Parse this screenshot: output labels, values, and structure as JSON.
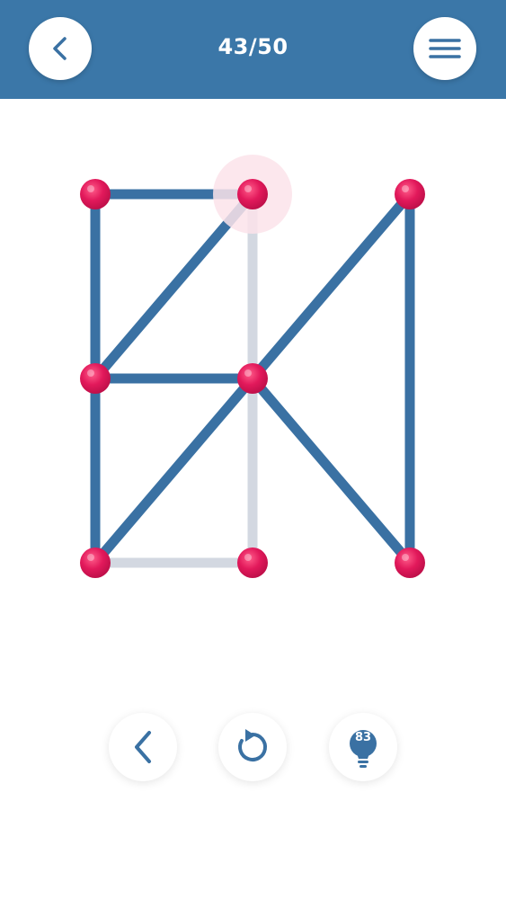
{
  "header": {
    "level_text": "43/50",
    "back_icon": "chevron-left-icon",
    "menu_icon": "hamburger-menu-icon"
  },
  "colors": {
    "header_bg": "#3b77a8",
    "drawn_line": "#3a71a3",
    "undrawn_line": "#d3d8e1",
    "node": "#e2195b",
    "node_highlight": "#fbe3ea"
  },
  "board": {
    "nodes": [
      {
        "id": "top-left"
      },
      {
        "id": "top-middle",
        "active": true
      },
      {
        "id": "top-right"
      },
      {
        "id": "middle-left"
      },
      {
        "id": "center"
      },
      {
        "id": "bottom-left"
      },
      {
        "id": "bottom-middle"
      },
      {
        "id": "bottom-right"
      }
    ],
    "edges": [
      {
        "from": "top-left",
        "to": "top-middle",
        "drawn": true
      },
      {
        "from": "top-left",
        "to": "middle-left",
        "drawn": true
      },
      {
        "from": "top-middle",
        "to": "middle-left",
        "drawn": true
      },
      {
        "from": "top-middle",
        "to": "center",
        "drawn": false
      },
      {
        "from": "top-right",
        "to": "center",
        "drawn": true
      },
      {
        "from": "top-right",
        "to": "bottom-right",
        "drawn": true
      },
      {
        "from": "middle-left",
        "to": "center",
        "drawn": true
      },
      {
        "from": "middle-left",
        "to": "bottom-left",
        "drawn": true
      },
      {
        "from": "center",
        "to": "bottom-left",
        "drawn": true
      },
      {
        "from": "center",
        "to": "bottom-middle",
        "drawn": false
      },
      {
        "from": "center",
        "to": "bottom-right",
        "drawn": true
      },
      {
        "from": "bottom-left",
        "to": "bottom-middle",
        "drawn": false
      }
    ]
  },
  "controls": {
    "undo_icon": "chevron-left-icon",
    "restart_icon": "restart-icon",
    "hint_icon": "lightbulb-icon",
    "hint_count": "83"
  }
}
